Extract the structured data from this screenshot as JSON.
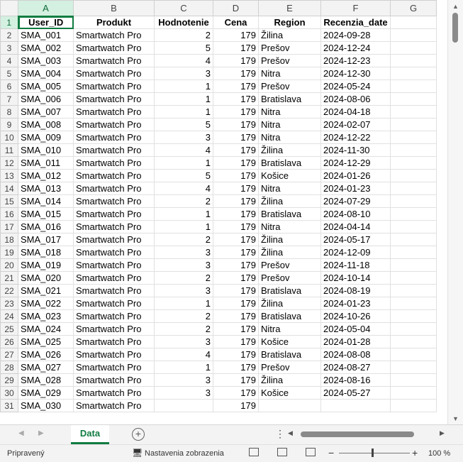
{
  "columns": [
    "A",
    "B",
    "C",
    "D",
    "E",
    "F",
    "G"
  ],
  "header": [
    "User_ID",
    "Produkt",
    "Hodnotenie",
    "Cena",
    "Region",
    "Recenzia_date",
    ""
  ],
  "rows": [
    [
      "SMA_001",
      "Smartwatch Pro",
      "2",
      "179",
      "Žilina",
      "2024-09-28"
    ],
    [
      "SMA_002",
      "Smartwatch Pro",
      "5",
      "179",
      "Prešov",
      "2024-12-24"
    ],
    [
      "SMA_003",
      "Smartwatch Pro",
      "4",
      "179",
      "Prešov",
      "2024-12-23"
    ],
    [
      "SMA_004",
      "Smartwatch Pro",
      "3",
      "179",
      "Nitra",
      "2024-12-30"
    ],
    [
      "SMA_005",
      "Smartwatch Pro",
      "1",
      "179",
      "Prešov",
      "2024-05-24"
    ],
    [
      "SMA_006",
      "Smartwatch Pro",
      "1",
      "179",
      "Bratislava",
      "2024-08-06"
    ],
    [
      "SMA_007",
      "Smartwatch Pro",
      "1",
      "179",
      "Nitra",
      "2024-04-18"
    ],
    [
      "SMA_008",
      "Smartwatch Pro",
      "5",
      "179",
      "Nitra",
      "2024-02-07"
    ],
    [
      "SMA_009",
      "Smartwatch Pro",
      "3",
      "179",
      "Nitra",
      "2024-12-22"
    ],
    [
      "SMA_010",
      "Smartwatch Pro",
      "4",
      "179",
      "Žilina",
      "2024-11-30"
    ],
    [
      "SMA_011",
      "Smartwatch Pro",
      "1",
      "179",
      "Bratislava",
      "2024-12-29"
    ],
    [
      "SMA_012",
      "Smartwatch Pro",
      "5",
      "179",
      "Košice",
      "2024-01-26"
    ],
    [
      "SMA_013",
      "Smartwatch Pro",
      "4",
      "179",
      "Nitra",
      "2024-01-23"
    ],
    [
      "SMA_014",
      "Smartwatch Pro",
      "2",
      "179",
      "Žilina",
      "2024-07-29"
    ],
    [
      "SMA_015",
      "Smartwatch Pro",
      "1",
      "179",
      "Bratislava",
      "2024-08-10"
    ],
    [
      "SMA_016",
      "Smartwatch Pro",
      "1",
      "179",
      "Nitra",
      "2024-04-14"
    ],
    [
      "SMA_017",
      "Smartwatch Pro",
      "2",
      "179",
      "Žilina",
      "2024-05-17"
    ],
    [
      "SMA_018",
      "Smartwatch Pro",
      "3",
      "179",
      "Žilina",
      "2024-12-09"
    ],
    [
      "SMA_019",
      "Smartwatch Pro",
      "3",
      "179",
      "Prešov",
      "2024-11-18"
    ],
    [
      "SMA_020",
      "Smartwatch Pro",
      "2",
      "179",
      "Prešov",
      "2024-10-14"
    ],
    [
      "SMA_021",
      "Smartwatch Pro",
      "3",
      "179",
      "Bratislava",
      "2024-08-19"
    ],
    [
      "SMA_022",
      "Smartwatch Pro",
      "1",
      "179",
      "Žilina",
      "2024-01-23"
    ],
    [
      "SMA_023",
      "Smartwatch Pro",
      "2",
      "179",
      "Bratislava",
      "2024-10-26"
    ],
    [
      "SMA_024",
      "Smartwatch Pro",
      "2",
      "179",
      "Nitra",
      "2024-05-04"
    ],
    [
      "SMA_025",
      "Smartwatch Pro",
      "3",
      "179",
      "Košice",
      "2024-01-28"
    ],
    [
      "SMA_026",
      "Smartwatch Pro",
      "4",
      "179",
      "Bratislava",
      "2024-08-08"
    ],
    [
      "SMA_027",
      "Smartwatch Pro",
      "1",
      "179",
      "Prešov",
      "2024-08-27"
    ],
    [
      "SMA_028",
      "Smartwatch Pro",
      "3",
      "179",
      "Žilina",
      "2024-08-16"
    ],
    [
      "SMA_029",
      "Smartwatch Pro",
      "3",
      "179",
      "Košice",
      "2024-05-27"
    ],
    [
      "SMA_030",
      "Smartwatch Pro",
      "",
      "179",
      "",
      ""
    ]
  ],
  "sheet_tab": "Data",
  "add_sheet_symbol": "+",
  "status": {
    "ready": "Pripravený",
    "display_settings": "Nastavenia zobrazenia",
    "zoom": "100 %"
  },
  "icons": [
    "up-arrow-icon",
    "down-arrow-icon",
    "left-arrow-icon",
    "right-arrow-icon",
    "display-settings-icon",
    "normal-view-icon",
    "page-layout-icon",
    "page-break-icon",
    "zoom-out-icon",
    "zoom-in-icon"
  ]
}
